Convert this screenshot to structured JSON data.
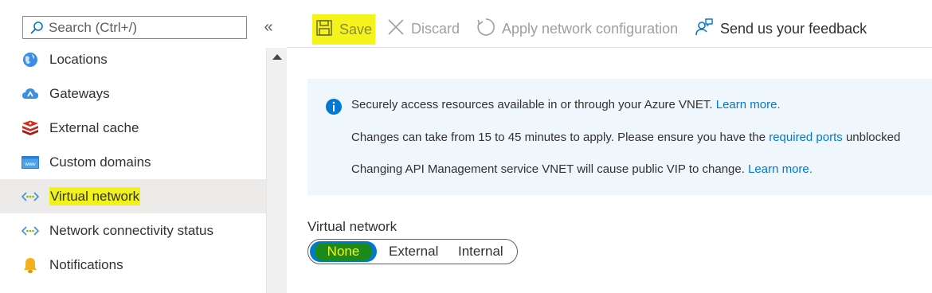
{
  "sidebar": {
    "search": {
      "placeholder": "Search (Ctrl+/)",
      "value": ""
    },
    "collapse_glyph": "«",
    "items": [
      {
        "label": "Locations",
        "icon": "globe-icon",
        "selected": false
      },
      {
        "label": "Gateways",
        "icon": "cloud-gateway-icon",
        "selected": false
      },
      {
        "label": "External cache",
        "icon": "redis-cache-icon",
        "selected": false
      },
      {
        "label": "Custom domains",
        "icon": "www-icon",
        "selected": false
      },
      {
        "label": "Virtual network",
        "icon": "vnet-icon",
        "selected": true
      },
      {
        "label": "Network connectivity status",
        "icon": "vnet-icon",
        "selected": false
      },
      {
        "label": "Notifications",
        "icon": "bell-icon",
        "selected": false
      }
    ]
  },
  "toolbar": {
    "save": "Save",
    "discard": "Discard",
    "apply": "Apply network configuration",
    "feedback": "Send us your feedback"
  },
  "banner": {
    "line1": {
      "text": "Securely access resources available in or through your Azure VNET. ",
      "link": "Learn more."
    },
    "line2": {
      "text": "Changes can take from 15 to 45 minutes to apply. Please ensure you have the ",
      "link": "required ports",
      "after": " unblocked"
    },
    "line3": {
      "text": "Changing API Management service VNET will cause public VIP to change. ",
      "link": "Learn more."
    }
  },
  "vnet": {
    "label": "Virtual network",
    "options": [
      "None",
      "External",
      "Internal"
    ],
    "selected": "None"
  },
  "colors": {
    "accent": "#0078d4",
    "highlight": "#f4f41b",
    "selected_bg": "#edebe9",
    "banner_bg": "#eff6fc"
  }
}
